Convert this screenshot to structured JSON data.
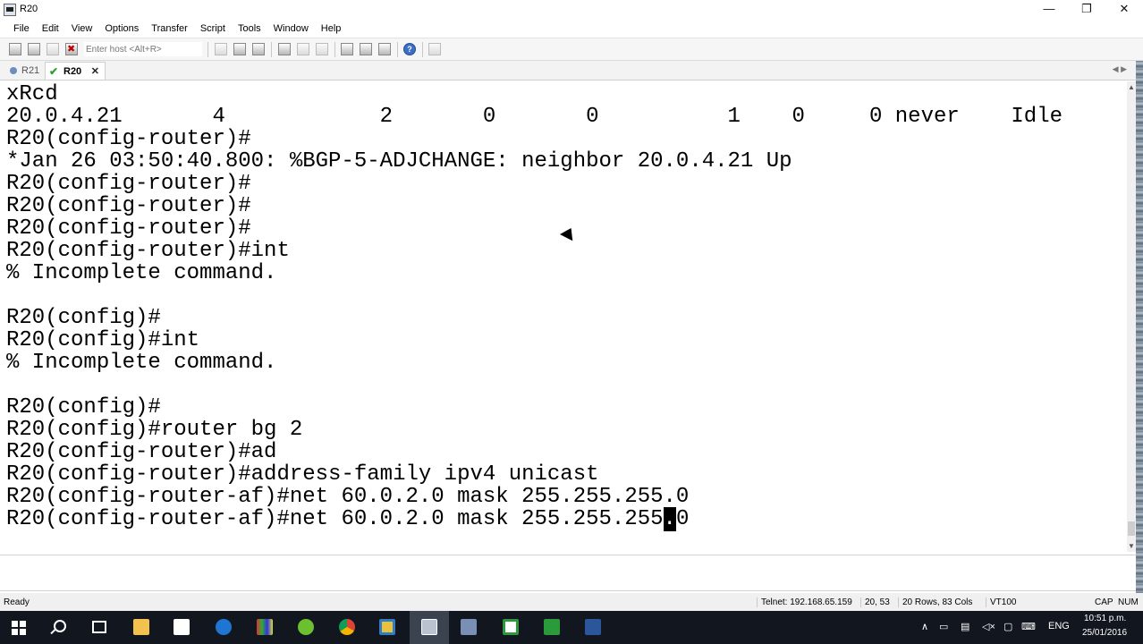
{
  "window": {
    "title": "R20",
    "minimize": "—",
    "restore": "❐",
    "close": "✕"
  },
  "menu": [
    "File",
    "Edit",
    "View",
    "Options",
    "Transfer",
    "Script",
    "Tools",
    "Window",
    "Help"
  ],
  "toolbar": {
    "host_placeholder": "Enter host <Alt+R>"
  },
  "tabs": [
    {
      "label": "R21",
      "active": false
    },
    {
      "label": "R20",
      "active": true,
      "close": "✕"
    }
  ],
  "tab_scroll": "◀ ▶",
  "terminal": {
    "lines": [
      "xRcd",
      "20.0.4.21       4            2       0       0          1    0     0 never    Idle",
      "R20(config-router)#",
      "*Jan 26 03:50:40.800: %BGP-5-ADJCHANGE: neighbor 20.0.4.21 Up",
      "R20(config-router)#",
      "R20(config-router)#",
      "R20(config-router)#",
      "R20(config-router)#int",
      "% Incomplete command.",
      "",
      "R20(config)#",
      "R20(config)#int",
      "% Incomplete command.",
      "",
      "R20(config)#",
      "R20(config)#router bg 2",
      "R20(config-router)#ad",
      "R20(config-router)#address-family ipv4 unicast",
      "R20(config-router-af)#net 60.0.2.0 mask 255.255.255.0"
    ],
    "last_line_before_cursor": "R20(config-router-af)#net 60.0.2.0 mask 255.255.255",
    "cursor_char": ".",
    "last_line_after_cursor": "0"
  },
  "status": {
    "ready": "Ready",
    "connection": "Telnet: 192.168.65.159",
    "position": "20, 53",
    "size": "20 Rows, 83 Cols",
    "emulation": "VT100",
    "caps": "CAP",
    "num": "NUM"
  },
  "taskbar": {
    "language": "ENG",
    "time": "10:51 p.m.",
    "date": "25/01/2016",
    "tray_up": "∧"
  },
  "colors": {
    "terminal_bg": "#ffffff",
    "terminal_fg": "#000000",
    "taskbar_bg": "#12161e",
    "active_tab_check": "#2ea12e"
  }
}
